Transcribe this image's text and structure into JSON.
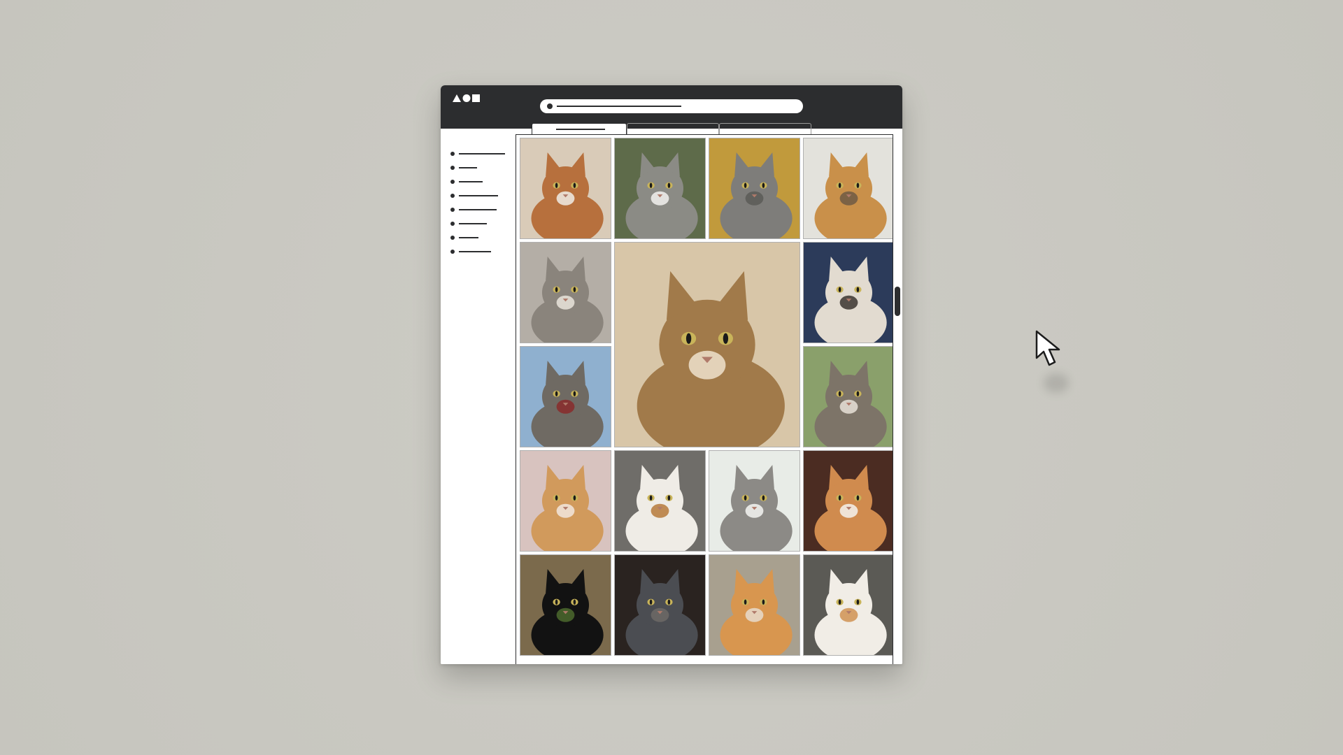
{
  "browser": {
    "logo_icon": "shapes-logo-icon",
    "address_icon": "address-dot-icon",
    "tabs": [
      {
        "name": "tab-active",
        "active": true
      },
      {
        "name": "tab-2",
        "active": false
      },
      {
        "name": "tab-3",
        "active": false
      }
    ]
  },
  "sidebar": {
    "items": [
      {
        "name": "sidebar-item-1"
      },
      {
        "name": "sidebar-item-2"
      },
      {
        "name": "sidebar-item-3"
      },
      {
        "name": "sidebar-item-4"
      },
      {
        "name": "sidebar-item-5"
      },
      {
        "name": "sidebar-item-6"
      },
      {
        "name": "sidebar-item-7"
      },
      {
        "name": "sidebar-item-8"
      }
    ]
  },
  "gallery": {
    "featured_photo": "tabby-cat-closeup",
    "photos": [
      {
        "name": "two-cats-cuddling",
        "fur": "#b7703d",
        "bg": "#d9cbb8",
        "accent": "#f0ece6"
      },
      {
        "name": "white-grey-cat",
        "fur": "#8b8b85",
        "bg": "#5e6b4a",
        "accent": "#f2f1ee"
      },
      {
        "name": "grey-tabby-sitting",
        "fur": "#7e7d7a",
        "bg": "#c19a3c",
        "accent": "#5b5a57"
      },
      {
        "name": "ginger-and-tabby-pair",
        "fur": "#c9904a",
        "bg": "#e3e2dc",
        "accent": "#6e5a44"
      },
      {
        "name": "grey-cat-upside-down",
        "fur": "#8a847c",
        "bg": "#b4aea6",
        "accent": "#e9e4dc"
      },
      {
        "name": "siamese-cat",
        "fur": "#e2dbd0",
        "bg": "#2c3b5a",
        "accent": "#3b3530"
      },
      {
        "name": "tabby-with-red-collar",
        "fur": "#6f6a63",
        "bg": "#8fb0cf",
        "accent": "#8a2a2a"
      },
      {
        "name": "tabby-portrait",
        "fur": "#7d7468",
        "bg": "#8aa06b",
        "accent": "#e8e2d8"
      },
      {
        "name": "ginger-cat-lying",
        "fur": "#d19a5c",
        "bg": "#d8c3bf",
        "accent": "#f2e6dd"
      },
      {
        "name": "calico-cat-lying",
        "fur": "#efece6",
        "bg": "#6f6d69",
        "accent": "#b67a3a"
      },
      {
        "name": "grey-kitten-sitting",
        "fur": "#8c8a86",
        "bg": "#e8ece7",
        "accent": "#f4f4f2"
      },
      {
        "name": "orange-white-cat",
        "fur": "#d08b4e",
        "bg": "#4b2c22",
        "accent": "#f5f2ee"
      },
      {
        "name": "black-cat-in-grass",
        "fur": "#121212",
        "bg": "#7b6a4c",
        "accent": "#4c6a2e"
      },
      {
        "name": "dark-grey-tabby",
        "fur": "#4b4d52",
        "bg": "#2a2320",
        "accent": "#6d6a66"
      },
      {
        "name": "orange-cat-resting",
        "fur": "#d8964f",
        "bg": "#a8a08f",
        "accent": "#e8dccc"
      },
      {
        "name": "white-ginger-cat-standing",
        "fur": "#f1ede6",
        "bg": "#5b5a55",
        "accent": "#d09252"
      }
    ]
  },
  "cursor_icon": "mouse-pointer-icon"
}
